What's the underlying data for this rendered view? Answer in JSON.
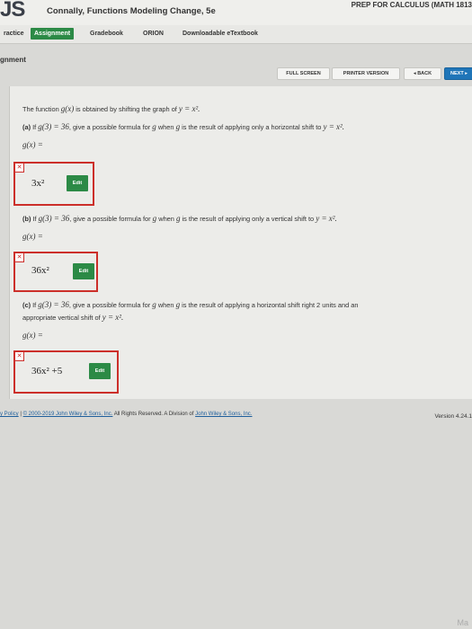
{
  "header": {
    "logo": "JS",
    "book_title": "Connally, Functions Modeling Change, 5e",
    "course": "PREP FOR CALCULUS (MATH 1813"
  },
  "nav": {
    "tabs": [
      {
        "label": "ractice"
      },
      {
        "label": "Assignment"
      },
      {
        "label": "Gradebook"
      },
      {
        "label": "ORION"
      },
      {
        "label": "Downloadable eTextbook"
      }
    ],
    "active_tab": "Assignment"
  },
  "page": {
    "section": "gnment"
  },
  "toolbar": {
    "full_screen": "FULL SCREEN",
    "printer_version": "PRINTER VERSION",
    "back": "◂ BACK",
    "next": "NEXT ▸"
  },
  "question": {
    "intro_prefix": "The function ",
    "intro_fn": "g(x)",
    "intro_suffix": " is obtained by shifting the graph of ",
    "intro_base": "y = x².",
    "parts": [
      {
        "label": "(a)",
        "prompt_1": " If ",
        "given": "g(3) = 36",
        "prompt_2": ", give a possible formula for ",
        "var": "g",
        "prompt_3": " when ",
        "var2": "g",
        "prompt_4": " is the result of applying only a horizontal shift to ",
        "base": "y = x².",
        "answer_label": "g(x) =",
        "answer": "3x²",
        "edit": "Edit"
      },
      {
        "label": "(b)",
        "prompt_1": " If ",
        "given": "g(3) = 36",
        "prompt_2": ", give a possible formula for ",
        "var": "g",
        "prompt_3": " when ",
        "var2": "g",
        "prompt_4": " is the result of applying only a vertical shift to ",
        "base": "y = x².",
        "answer_label": "g(x) =",
        "answer": "36x²",
        "edit": "Edit"
      },
      {
        "label": "(c)",
        "prompt_1": " If ",
        "given": "g(3) = 36",
        "prompt_2": ", give a possible formula for ",
        "var": "g",
        "prompt_3": " when ",
        "var2": "g",
        "prompt_4": " is the result of applying a horizontal shift right 2 units and an",
        "prompt_line2": "appropriate vertical shift of ",
        "base": "y = x².",
        "answer_label": "g(x) =",
        "answer": "36x² +5",
        "edit": "Edit"
      }
    ]
  },
  "footer": {
    "policy": "y Policy",
    "sep": " | ",
    "copyright": "© 2000-2019 John Wiley & Sons, Inc.",
    "rights": " All Rights Reserved. A Division of ",
    "company": "John Wiley & Sons, Inc.",
    "version": "Version 4.24.1"
  },
  "corner_text": "Ma",
  "colors": {
    "accent_green": "#2c8a46",
    "error_red": "#cc2f2a",
    "link_blue": "#1f5f9c",
    "next_blue": "#1f75b8"
  }
}
